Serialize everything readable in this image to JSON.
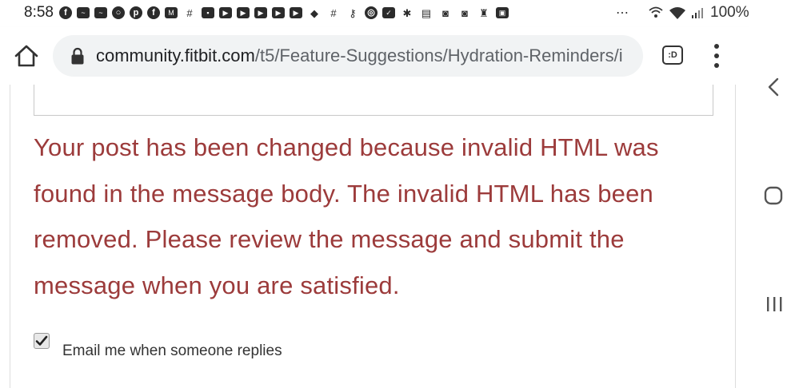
{
  "status_bar": {
    "time": "8:58",
    "notification_icons": [
      "facebook-icon",
      "messenger-icon",
      "messenger-icon",
      "circle-app-icon",
      "pinterest-icon",
      "facebook-icon",
      "gmail-icon",
      "slack-icon",
      "ifttt-icon",
      "youtube-icon",
      "youtube-icon",
      "youtube-icon",
      "youtube-icon",
      "youtube-icon",
      "game-icon",
      "slack-icon",
      "key-icon",
      "chrome-icon",
      "check-box-icon",
      "walmart-icon",
      "book-icon",
      "instagram-icon",
      "instagram-icon",
      "keyhole-icon",
      "photo-icon"
    ],
    "more_indicator": "⋯",
    "battery_text": "100%"
  },
  "browser": {
    "url_domain": "community.fitbit.com",
    "url_path": "/t5/Feature-Suggestions/Hydration-Reminders/i",
    "tab_button_label": ":D"
  },
  "page": {
    "error_message": "Your post has been changed because invalid HTML was found in the message body. The invalid HTML has been removed. Please review the message and submit the message when you are satisfied.",
    "email_checkbox_checked": true,
    "email_label": "Email me when someone replies"
  },
  "colors": {
    "error_text": "#9c3b3b",
    "url_bar_bg": "#f1f3f4"
  }
}
